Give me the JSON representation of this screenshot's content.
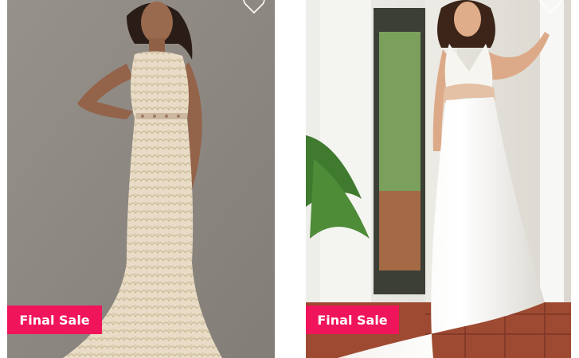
{
  "products": [
    {
      "image_subject": "lace sheath wedding dress",
      "badge": "Final Sale",
      "wishlist_icon": "heart-outline-icon"
    },
    {
      "image_subject": "halter ball gown wedding dress with sash",
      "badge": "Final Sale",
      "wishlist_icon": "heart-outline-icon"
    }
  ],
  "colors": {
    "badge": "#f0145a",
    "badge_text": "#ffffff"
  }
}
